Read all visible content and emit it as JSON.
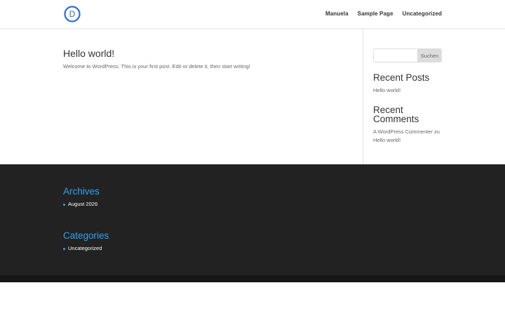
{
  "header": {
    "logo_letter": "D",
    "nav": [
      {
        "label": "Manuela"
      },
      {
        "label": "Sample Page"
      },
      {
        "label": "Uncategorized"
      }
    ]
  },
  "post": {
    "title": "Hello world!",
    "excerpt": "Welcome to WordPress. This is your first post. Edit or delete it, then start writing!"
  },
  "sidebar": {
    "search": {
      "placeholder": "",
      "button_label": "Suchen"
    },
    "recent_posts": {
      "title": "Recent Posts",
      "items": [
        "Hello world!"
      ]
    },
    "recent_comments": {
      "title": "Recent Comments",
      "author": "A WordPress Commenter",
      "connector": "zu",
      "post": "Hello world!"
    }
  },
  "footer": {
    "archives": {
      "title": "Archives",
      "items": [
        "August 2026"
      ]
    },
    "categories": {
      "title": "Categories",
      "items": [
        "Uncategorized"
      ]
    }
  },
  "colors": {
    "accent": "#2ea3f2",
    "footer_bg": "#222222",
    "bottom_bar": "#171717",
    "logo": "#2e6ddb"
  }
}
